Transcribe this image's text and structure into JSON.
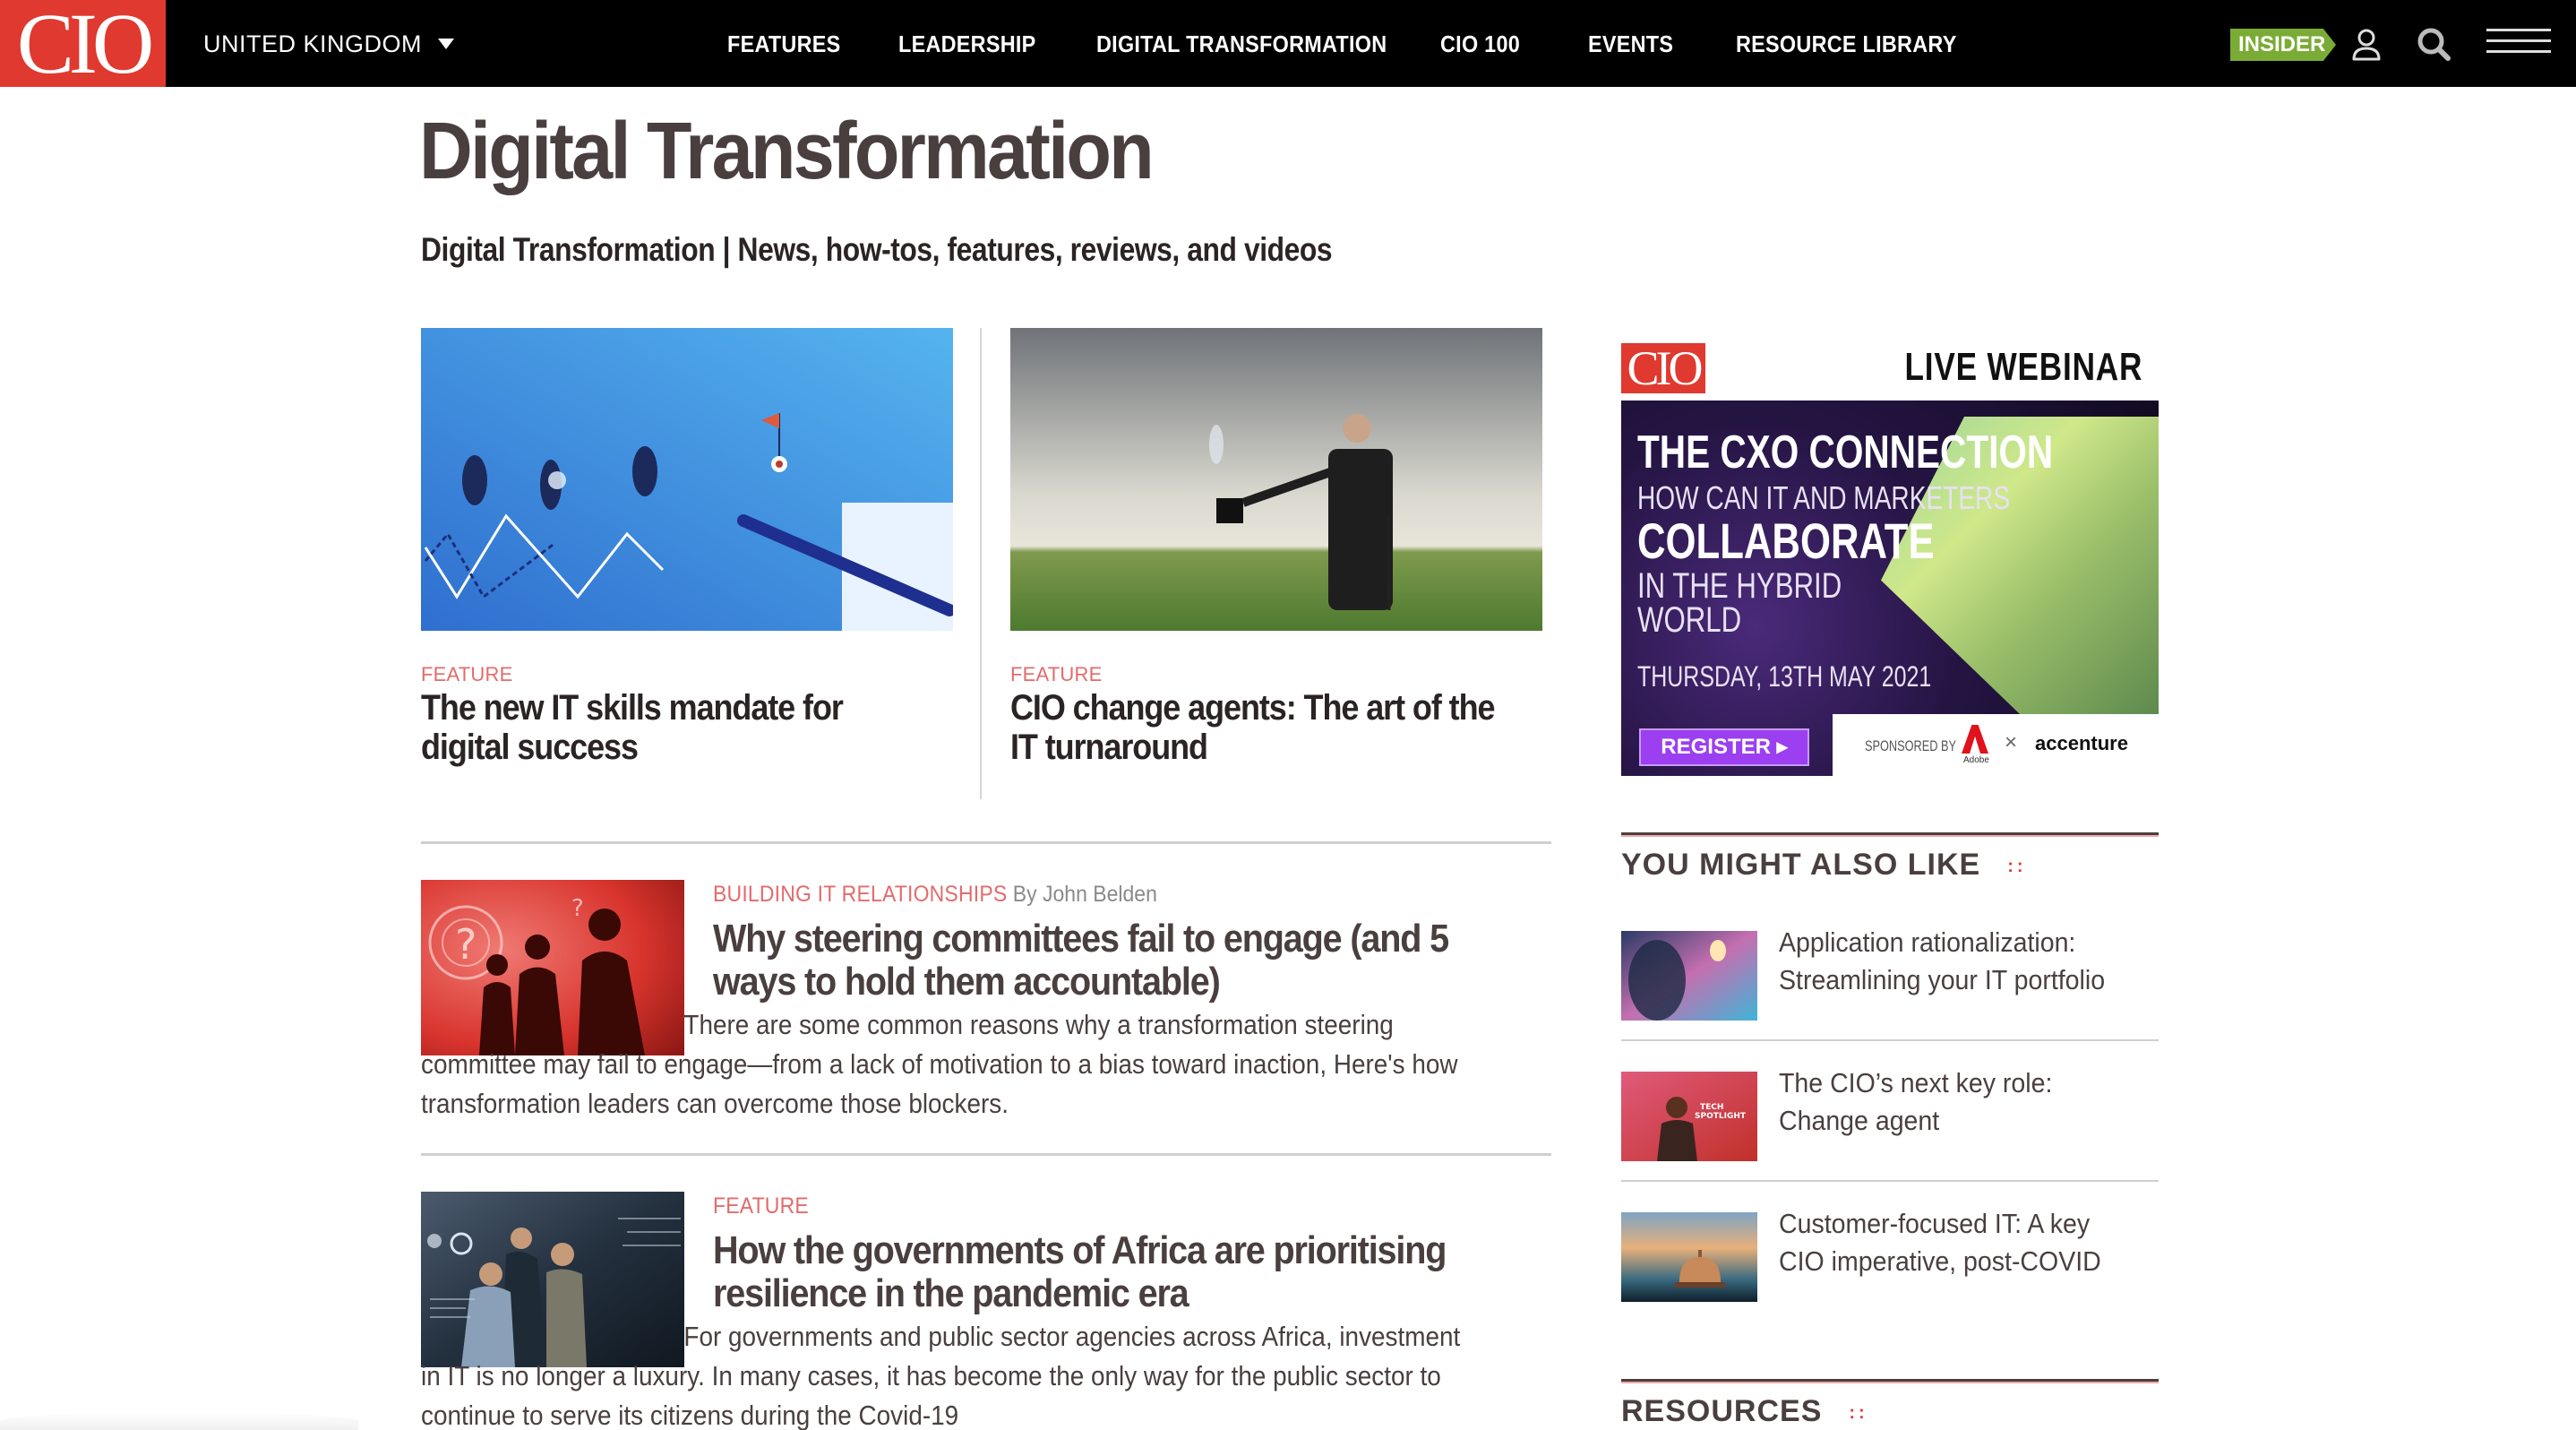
{
  "nav": {
    "logo": "CIO",
    "region": "UNITED KINGDOM",
    "items": [
      {
        "label": "FEATURES"
      },
      {
        "label": "LEADERSHIP"
      },
      {
        "label": "DIGITAL TRANSFORMATION"
      },
      {
        "label": "CIO 100"
      },
      {
        "label": "EVENTS"
      },
      {
        "label": "RESOURCE LIBRARY"
      }
    ],
    "insider": "INSIDER",
    "icons": {
      "account": "user-icon",
      "search": "search-icon",
      "menu": "hamburger-menu-icon"
    }
  },
  "page": {
    "title": "Digital Transformation",
    "subtitle": "Digital Transformation | News, how-tos, features, reviews, and videos"
  },
  "features": [
    {
      "kicker": "FEATURE",
      "headline": "The new IT skills mandate for digital success",
      "image": "illustration-runners-graph"
    },
    {
      "kicker": "FEATURE",
      "headline": "CIO change agents: The art of the IT turnaround",
      "image": "magician-in-field"
    }
  ],
  "articles": [
    {
      "kicker": "BUILDING IT RELATIONSHIPS",
      "byline": "By John Belden",
      "headline": "Why steering committees fail to engage (and 5 ways to hold them accountable)",
      "summary": "There are some common reasons why a transformation steering committee may fail to engage—from a lack of motivation to a bias toward inaction, Here's how transformation leaders can overcome those blockers.",
      "image": "red-meeting-silhouettes"
    },
    {
      "kicker": "FEATURE",
      "byline": "",
      "headline": "How the governments of Africa are prioritising resilience in the pandemic era",
      "summary": "For governments and public sector agencies across Africa, investment in IT is no longer a luxury. In many cases, it has become the only way for the public sector to continue to serve its citizens during the Covid-19",
      "image": "team-at-screen"
    }
  ],
  "ad": {
    "logo": "CIO",
    "live": "LIVE WEBINAR",
    "line1": "THE CXO CONNECTION",
    "line2": "HOW CAN IT AND MARKETERS",
    "line3": "COLLABORATE",
    "line4": "IN THE HYBRID\nWORLD",
    "date": "THURSDAY, 13TH MAY 2021",
    "register": "REGISTER ▸",
    "sponsored_by": "SPONSORED BY",
    "sponsor1": "Adobe",
    "times": "×",
    "sponsor2": "accenture"
  },
  "sidebar": {
    "also_like_heading": "YOU MIGHT ALSO LIKE",
    "dots": "::",
    "items": [
      {
        "title": "Application rationalization: Streamlining your IT portfolio"
      },
      {
        "title": "The CIO’s next key role: Change agent"
      },
      {
        "title": "Customer-focused IT: A key CIO imperative, post-COVID"
      }
    ],
    "resources_heading": "RESOURCES"
  },
  "colors": {
    "brand_red": "#e0392f",
    "kicker": "#e36b6b",
    "insider_green": "#7aac35",
    "text": "#4a3f3f",
    "nav_bg": "#000000"
  }
}
